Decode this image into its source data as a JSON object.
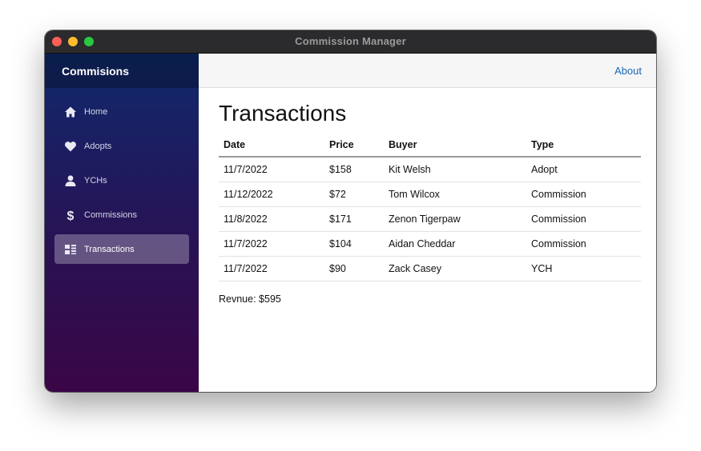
{
  "window": {
    "title": "Commission Manager"
  },
  "sidebar": {
    "brand": "Commisions",
    "items": [
      {
        "label": "Home",
        "icon": "home-icon"
      },
      {
        "label": "Adopts",
        "icon": "heart-icon"
      },
      {
        "label": "YCHs",
        "icon": "person-icon"
      },
      {
        "label": "Commissions",
        "icon": "dollar-icon"
      },
      {
        "label": "Transactions",
        "icon": "list-icon",
        "active": true
      }
    ]
  },
  "topbar": {
    "about_label": "About"
  },
  "page": {
    "title": "Transactions",
    "table": {
      "headers": [
        "Date",
        "Price",
        "Buyer",
        "Type"
      ],
      "rows": [
        [
          "11/7/2022",
          "$158",
          "Kit Welsh",
          "Adopt"
        ],
        [
          "11/12/2022",
          "$72",
          "Tom Wilcox",
          "Commission"
        ],
        [
          "11/8/2022",
          "$171",
          "Zenon Tigerpaw",
          "Commission"
        ],
        [
          "11/7/2022",
          "$104",
          "Aidan Cheddar",
          "Commission"
        ],
        [
          "11/7/2022",
          "$90",
          "Zack Casey",
          "YCH"
        ]
      ]
    },
    "revenue_label": "Revnue:",
    "revenue_value": "$595"
  },
  "colors": {
    "sidebar_top": "#0f2a6b",
    "sidebar_bottom": "#3a0647",
    "link": "#1868b5"
  }
}
